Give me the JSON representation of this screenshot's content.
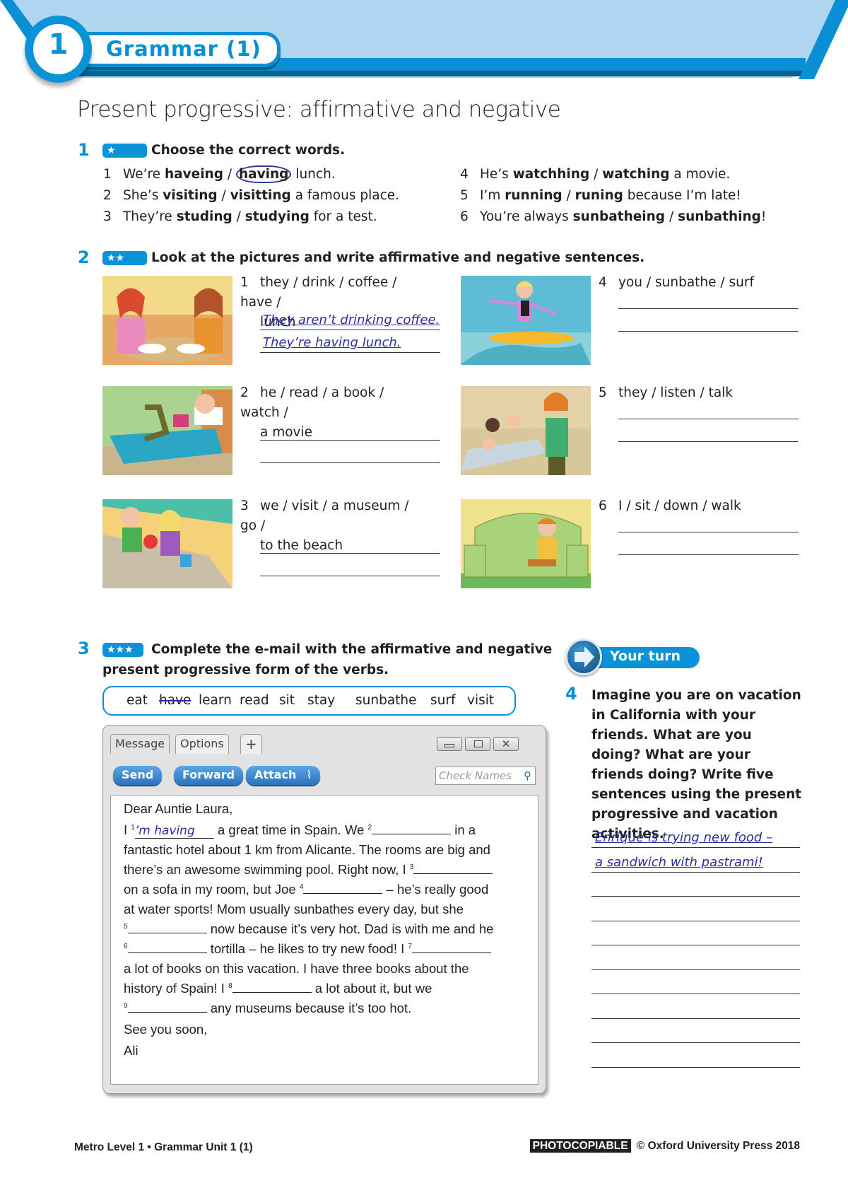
{
  "header": {
    "unit_number": "1",
    "section_title": "Grammar (1)",
    "page_heading": "Present progressive: affirmative and negative",
    "colors": {
      "accent": "#0a8ed4",
      "banner_bg": "#afd5f0",
      "handwriting": "#2b2f9e"
    }
  },
  "exercise1": {
    "number": "1",
    "stars": "★",
    "instruction": "Choose the correct words.",
    "items": [
      {
        "n": "1",
        "pre": "We’re ",
        "opt1": "haveing",
        "opt2": "having",
        "post": " lunch.",
        "circled": "opt2"
      },
      {
        "n": "2",
        "pre": "She’s ",
        "opt1": "visiting",
        "opt2": "visitting",
        "post": " a famous place."
      },
      {
        "n": "3",
        "pre": "They’re ",
        "opt1": "studing",
        "opt2": "studying",
        "post": " for a test."
      },
      {
        "n": "4",
        "pre": "He’s ",
        "opt1": "watchhing",
        "opt2": "watching",
        "post": " a movie."
      },
      {
        "n": "5",
        "pre": "I’m ",
        "opt1": "running",
        "opt2": "runing",
        "post": " because I’m late!"
      },
      {
        "n": "6",
        "pre": "You’re always ",
        "opt1": "sunbatheing",
        "opt2": "sunbathing",
        "post": "!"
      }
    ],
    "separator": " / "
  },
  "exercise2": {
    "number": "2",
    "stars": "★★",
    "instruction": "Look at the pictures and write affirmative and negative sentences.",
    "items": [
      {
        "n": "1",
        "line1": "they / drink / coffee / have /",
        "line2": "lunch",
        "picture": "restaurant-lunch",
        "answers": [
          "They aren’t drinking coffee.",
          "They’re having lunch."
        ]
      },
      {
        "n": "2",
        "line1": "he / read / a book / watch /",
        "line2": "a movie",
        "picture": "boy-reading-in-bed",
        "answers": []
      },
      {
        "n": "3",
        "line1": "we / visit / a museum / go /",
        "line2": "to the beach",
        "picture": "couple-at-beach",
        "answers": []
      },
      {
        "n": "4",
        "line1": "you / sunbathe / surf",
        "line2": "",
        "picture": "girl-surfing",
        "answers": []
      },
      {
        "n": "5",
        "line1": "they / listen / talk",
        "line2": "",
        "picture": "classroom-talking",
        "answers": []
      },
      {
        "n": "6",
        "line1": "I / sit / down / walk",
        "line2": "",
        "picture": "boy-on-sofa",
        "answers": []
      }
    ]
  },
  "exercise3": {
    "number": "3",
    "stars": "★★★",
    "instruction_line1": "Complete the e-mail with the affirmative and negative",
    "instruction_line2": "present progressive form of the verbs.",
    "word_box": [
      "eat",
      "have",
      "learn",
      "read",
      "sit",
      "stay",
      "sunbathe",
      "surf",
      "visit"
    ],
    "struck_word": "have",
    "email_window": {
      "tabs": [
        "Message",
        "Options",
        "+"
      ],
      "buttons": [
        "Send",
        "Forward",
        "Attach"
      ],
      "search_placeholder": "Check Names",
      "greeting": "Dear Auntie Laura,",
      "answer1": "’m having",
      "lines": [
        {
          "a": "I ",
          "s1": "1",
          "b": " a great time in Spain. We ",
          "s2": "2",
          "c": " in a"
        },
        {
          "text": "fantastic hotel about 1 km from Alicante. The rooms are big and"
        },
        {
          "a": "there’s an awesome swimming pool. Right now, I ",
          "s1": "3"
        },
        {
          "a": "on a sofa in my room, but Joe ",
          "s1": "4",
          "b": " – he’s really good"
        },
        {
          "text": "at water sports! Mom usually sunbathes every day, but she"
        },
        {
          "s1": "5",
          "b": " now because it’s very hot. Dad is with me and he"
        },
        {
          "s1": "6",
          "b": " tortilla – he likes to try new food! I ",
          "s2": "7"
        },
        {
          "text": "a lot of books on this vacation. I have three books about the"
        },
        {
          "a": "history of Spain! I ",
          "s1": "8",
          "b": " a lot about it, but we"
        },
        {
          "s1": "9",
          "b": " any museums because it’s too hot."
        }
      ],
      "signoff": "See you soon,",
      "signature": "Ali"
    }
  },
  "your_turn": {
    "label": "Your turn",
    "number": "4",
    "instruction": "Imagine you are on vacation in California with your friends. What are you doing? What are your friends doing? Write five sentences using the present progressive and vacation activities.",
    "answers": [
      "Enrique is trying new food –",
      "a sandwich with pastrami!"
    ]
  },
  "footer": {
    "left": "Metro Level 1  •  Grammar Unit 1 (1)",
    "badge": "PHOTOCOPIABLE",
    "right": "© Oxford University Press 2018"
  }
}
